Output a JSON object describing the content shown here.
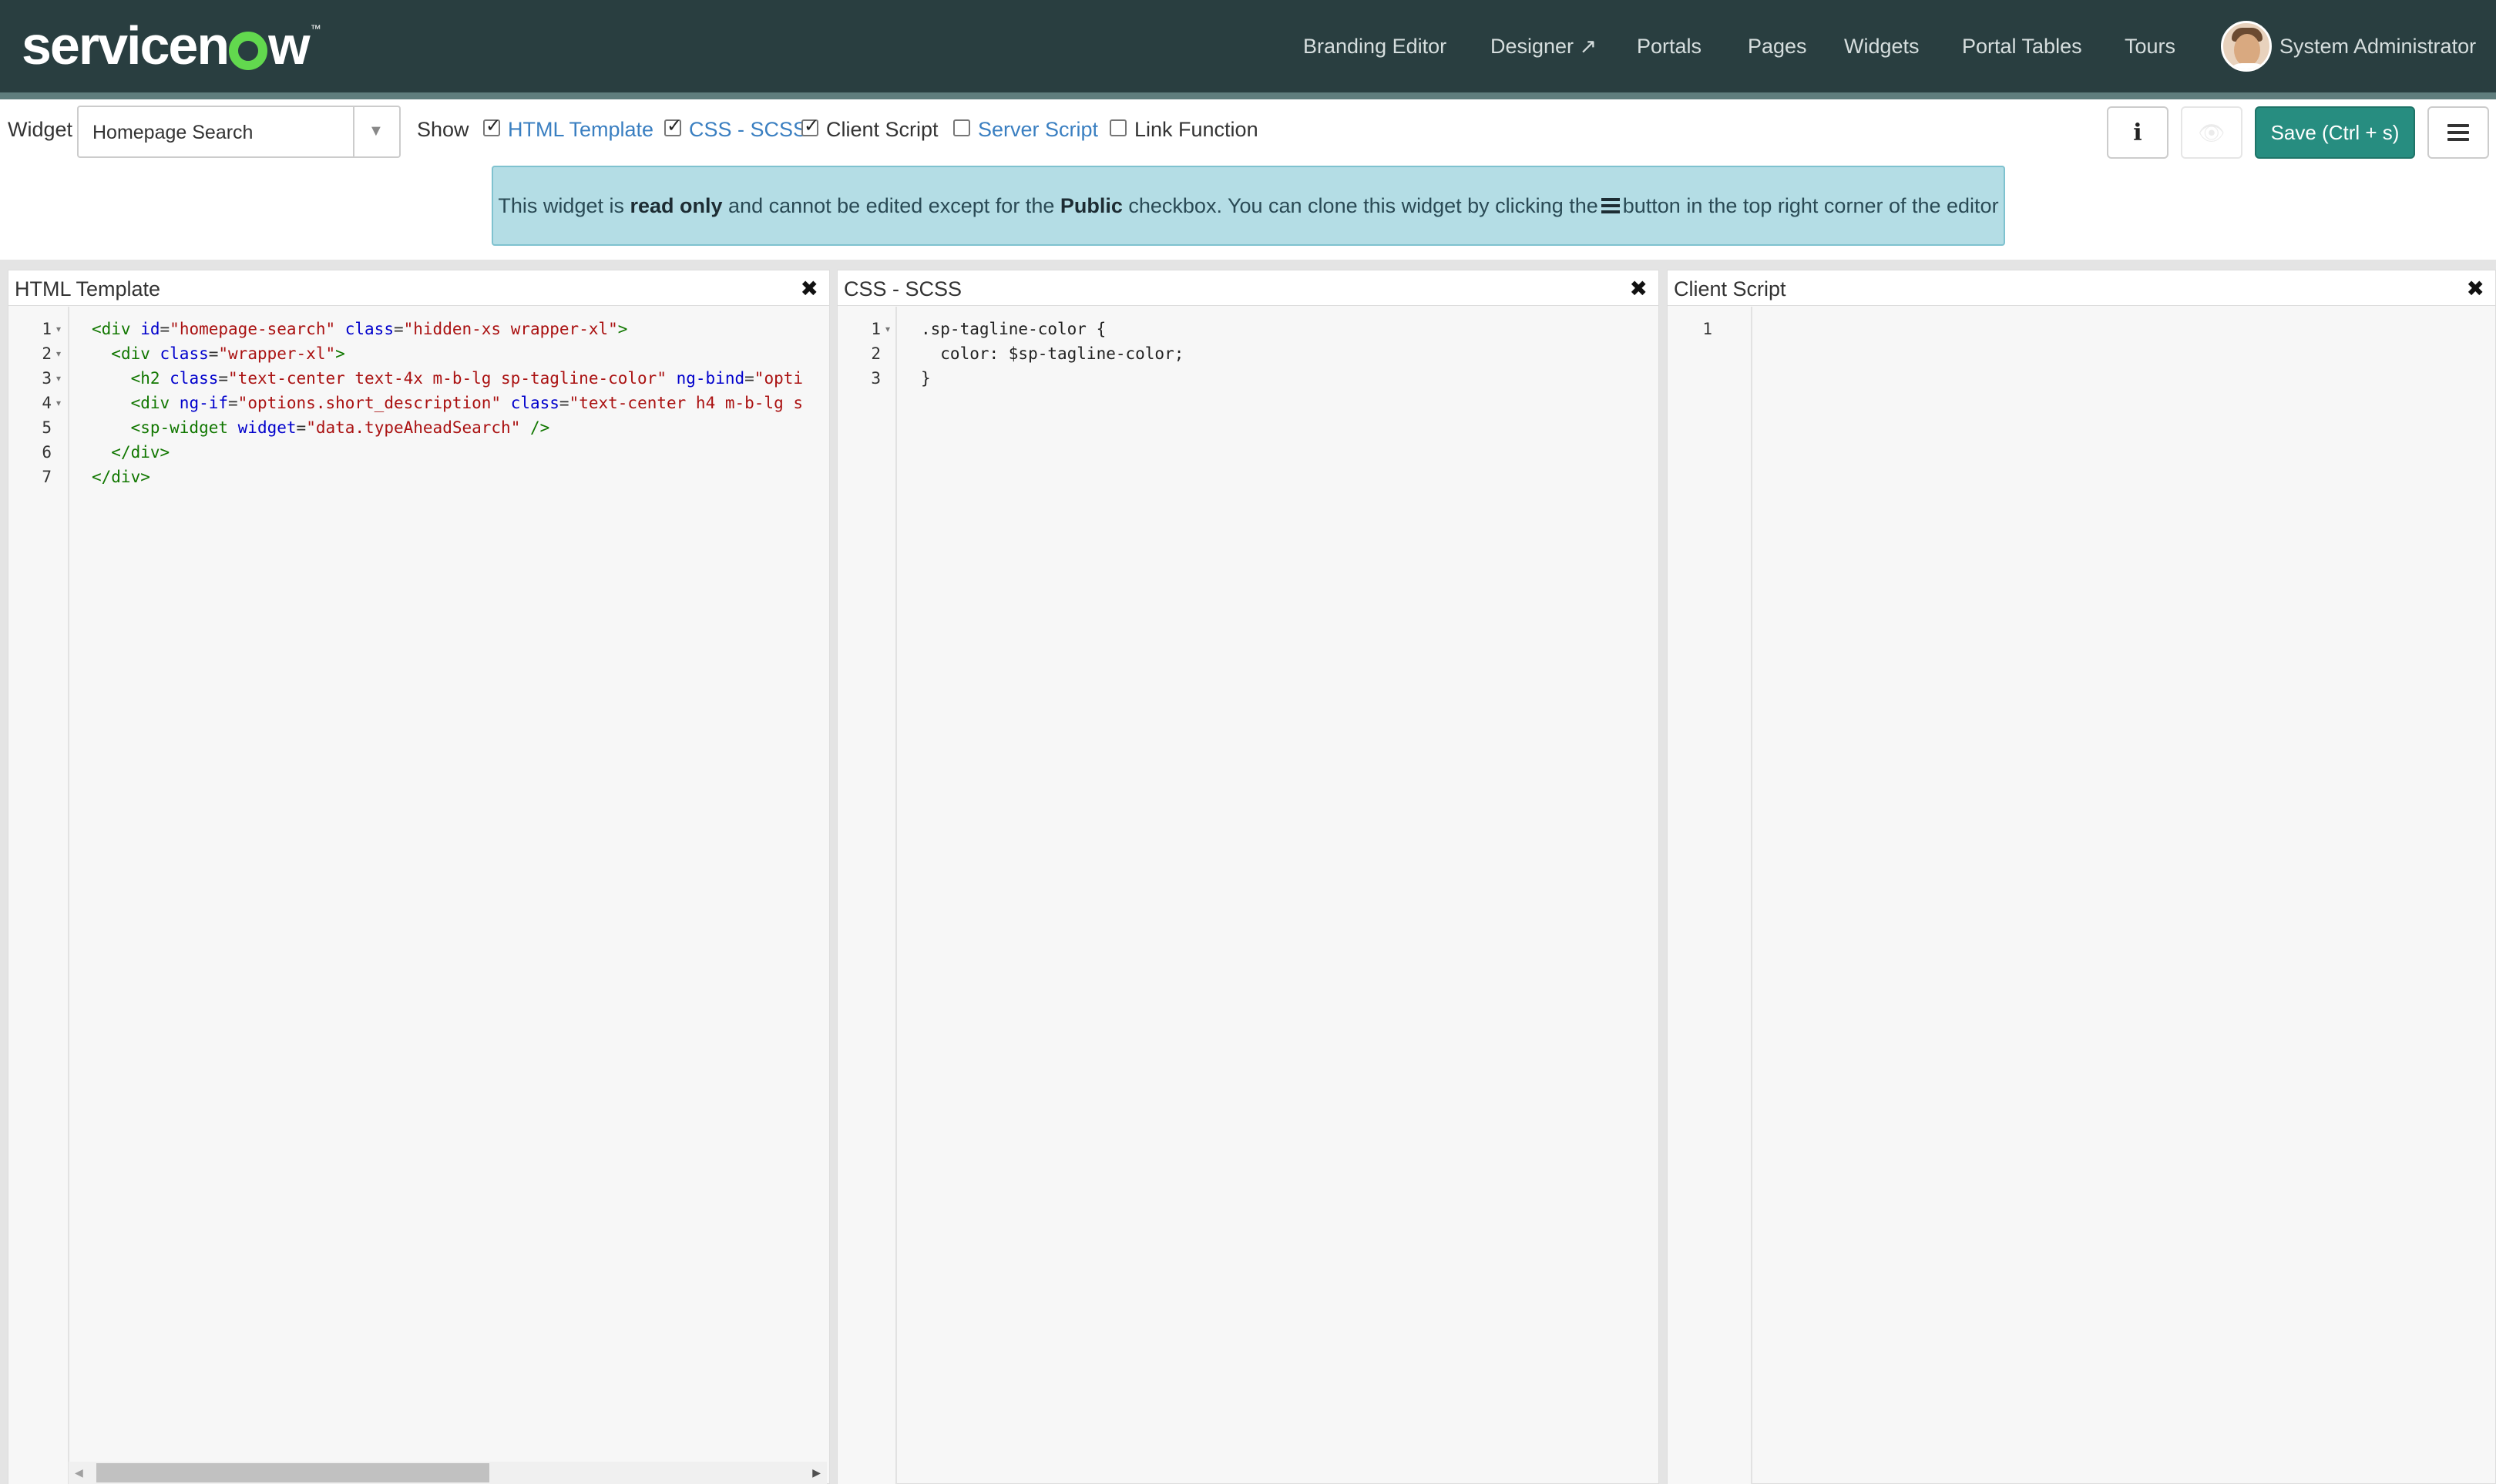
{
  "brand": {
    "logo_text_a": "servicen",
    "logo_text_b": "w",
    "logo_tm": "™"
  },
  "topnav": {
    "links": [
      {
        "label": "Branding Editor"
      },
      {
        "label": "Designer ↗"
      },
      {
        "label": "Portals"
      },
      {
        "label": "Pages"
      },
      {
        "label": "Widgets"
      },
      {
        "label": "Portal Tables"
      },
      {
        "label": "Tours"
      }
    ],
    "user_name": "System Administrator",
    "avatar_icon": "user-avatar"
  },
  "toolbar": {
    "widget_label": "Widget",
    "widget_value": "Homepage Search",
    "dropdown_arrow": "▼",
    "show_label": "Show",
    "toggles": [
      {
        "label": "HTML Template",
        "checked": true
      },
      {
        "label": "CSS - SCSS",
        "checked": true
      },
      {
        "label": "Client Script",
        "checked": true
      },
      {
        "label": "Server Script",
        "checked": false
      },
      {
        "label": "Link Function",
        "checked": false
      }
    ],
    "info_glyph": "i",
    "hide_glyph": "👁",
    "save_label": "Save (Ctrl + s)"
  },
  "alert": {
    "part1": "This widget is ",
    "bold1": "read only",
    "part2": " and cannot be edited except for the ",
    "bold2": "Public",
    "part3": " checkbox. You can clone this widget by clicking the",
    "part4": "button in the top right corner of the editor"
  },
  "panes": {
    "html": {
      "title": "HTML Template",
      "close": "✖",
      "line_numbers": [
        "1",
        "2",
        "3",
        "4",
        "5",
        "6",
        "7"
      ],
      "fold_marks": [
        "▾",
        "▾",
        "▾",
        "▾",
        "",
        "",
        ""
      ],
      "lines": [
        {
          "indent": "",
          "tag_open": "<div",
          "attrs": [
            [
              " id",
              "=",
              "\"homepage-search\""
            ],
            [
              " class",
              "=",
              "\"hidden-xs wrapper-xl\""
            ]
          ],
          "tag_close": ">"
        },
        {
          "indent": "  ",
          "tag_open": "<div",
          "attrs": [
            [
              " class",
              "=",
              "\"wrapper-xl\""
            ]
          ],
          "tag_close": ">"
        },
        {
          "indent": "    ",
          "tag_open": "<h2",
          "attrs": [
            [
              " class",
              "=",
              "\"text-center text-4x m-b-lg sp-tagline-color\""
            ],
            [
              " ng-bind",
              "=",
              "\"opti"
            ]
          ],
          "tag_close": ""
        },
        {
          "indent": "    ",
          "tag_open": "<div",
          "attrs": [
            [
              " ng-if",
              "=",
              "\"options.short_description\""
            ],
            [
              " class",
              "=",
              "\"text-center h4 m-b-lg s"
            ]
          ],
          "tag_close": ""
        },
        {
          "indent": "    ",
          "tag_open": "<sp-widget",
          "attrs": [
            [
              " widget",
              "=",
              "\"data.typeAheadSearch\""
            ]
          ],
          "tag_close": " />"
        },
        {
          "indent": "  ",
          "tag_open": "</div>",
          "attrs": [],
          "tag_close": ""
        },
        {
          "indent": "",
          "tag_open": "</div>",
          "attrs": [],
          "tag_close": ""
        }
      ]
    },
    "css": {
      "title": "CSS - SCSS",
      "close": "✖",
      "line_numbers": [
        "1",
        "2",
        "3"
      ],
      "fold_marks": [
        "▾",
        "",
        ""
      ],
      "lines": [
        ".sp-tagline-color {",
        "  color: $sp-tagline-color;",
        "}"
      ]
    },
    "client": {
      "title": "Client Script",
      "close": "✖",
      "line_numbers": [
        "1"
      ]
    }
  },
  "scrollbar": {
    "left_arrow": "◀",
    "right_arrow": "▶"
  }
}
